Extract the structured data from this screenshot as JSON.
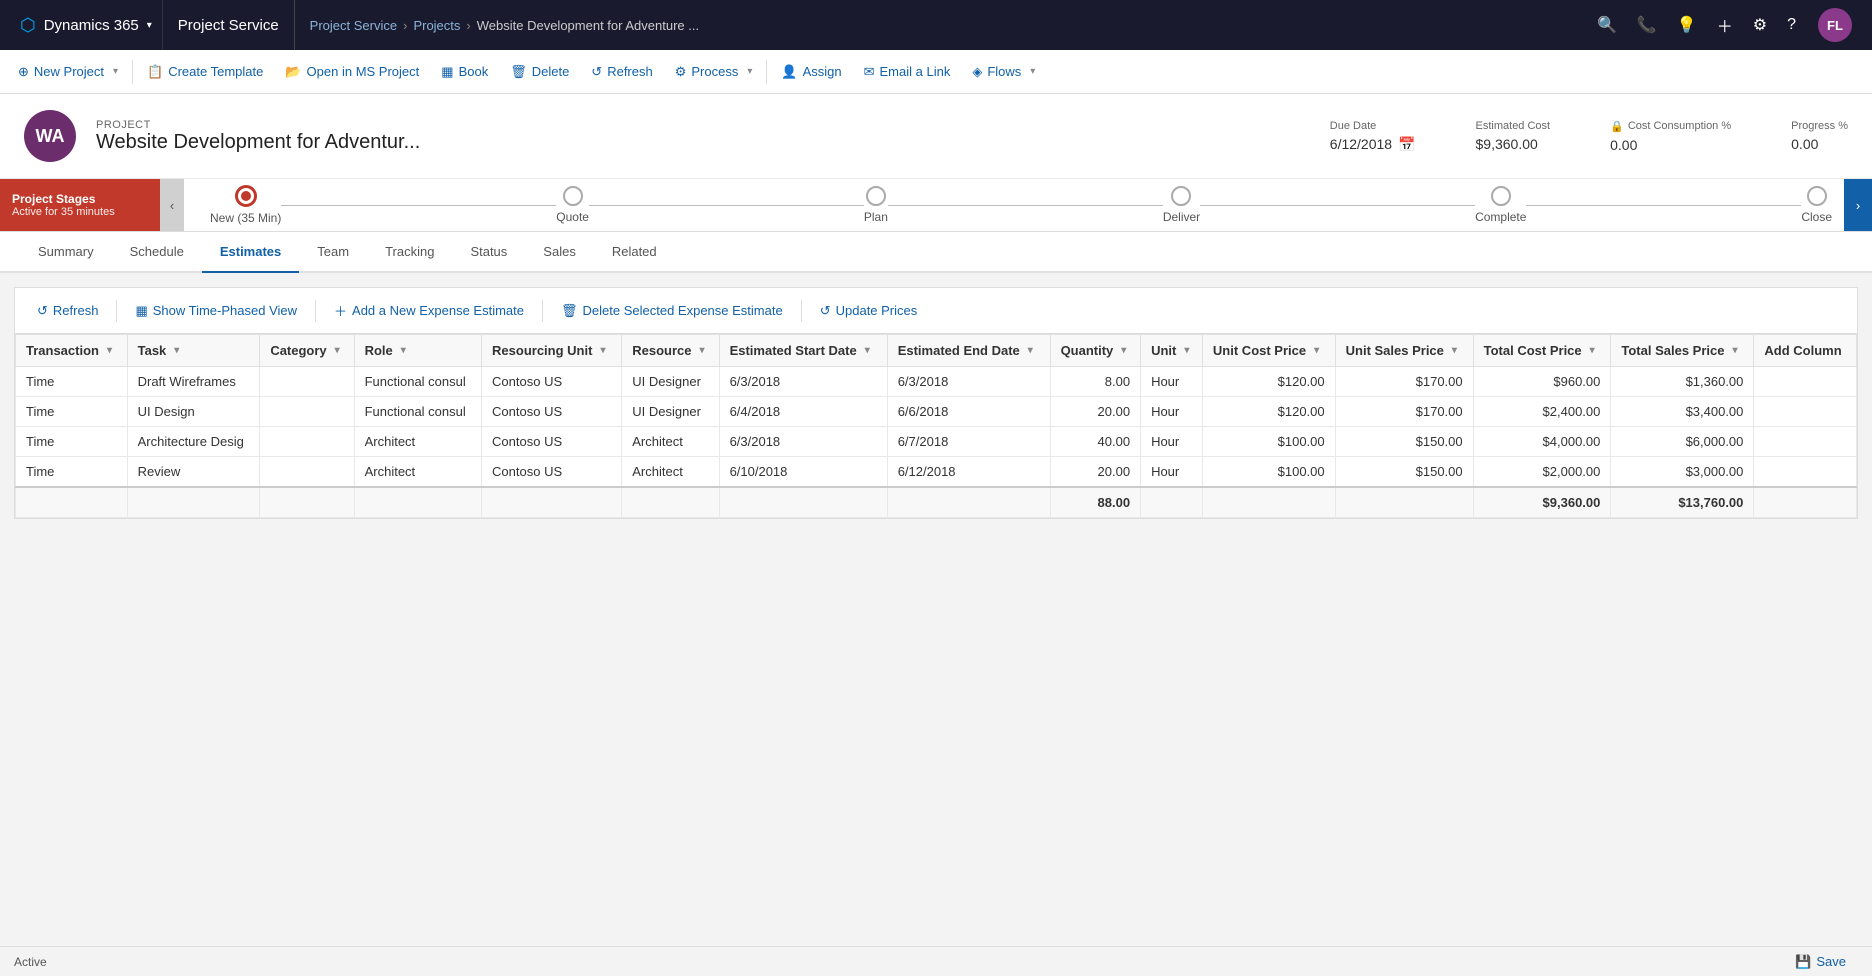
{
  "topNav": {
    "dynamics365": "Dynamics 365",
    "projectService": "Project Service",
    "breadcrumb": [
      "Project Service",
      "Projects",
      "Website Development for Adventure ..."
    ],
    "userInitials": "FL",
    "icons": [
      "search",
      "phone",
      "lightbulb",
      "plus",
      "settings",
      "question"
    ]
  },
  "commandBar": {
    "buttons": [
      {
        "id": "new-project",
        "label": "New Project",
        "icon": "⊕",
        "hasSplit": true
      },
      {
        "id": "create-template",
        "label": "Create Template",
        "icon": "📋"
      },
      {
        "id": "open-ms-project",
        "label": "Open in MS Project",
        "icon": "📁"
      },
      {
        "id": "book",
        "label": "Book",
        "icon": "▦"
      },
      {
        "id": "delete",
        "label": "Delete",
        "icon": "🗑"
      },
      {
        "id": "refresh",
        "label": "Refresh",
        "icon": "↺"
      },
      {
        "id": "process",
        "label": "Process",
        "icon": "⚙",
        "hasSplit": true
      },
      {
        "id": "assign",
        "label": "Assign",
        "icon": "👤"
      },
      {
        "id": "email-link",
        "label": "Email a Link",
        "icon": "✉"
      },
      {
        "id": "flows",
        "label": "Flows",
        "icon": "◈",
        "hasSplit": true
      }
    ]
  },
  "project": {
    "label": "PROJECT",
    "title": "Website Development for Adventur...",
    "iconText": "WA",
    "dueDate": {
      "label": "Due Date",
      "value": "6/12/2018"
    },
    "estimatedCost": {
      "label": "Estimated Cost",
      "value": "$9,360.00"
    },
    "costConsumption": {
      "label": "Cost Consumption %",
      "value": "0.00"
    },
    "progress": {
      "label": "Progress %",
      "value": "0.00"
    }
  },
  "stages": {
    "panelTitle": "Project Stages",
    "panelSub": "Active for 35 minutes",
    "steps": [
      {
        "label": "New (35 Min)",
        "active": true
      },
      {
        "label": "Quote",
        "active": false
      },
      {
        "label": "Plan",
        "active": false
      },
      {
        "label": "Deliver",
        "active": false
      },
      {
        "label": "Complete",
        "active": false
      },
      {
        "label": "Close",
        "active": false
      }
    ]
  },
  "tabs": [
    {
      "id": "summary",
      "label": "Summary",
      "active": false
    },
    {
      "id": "schedule",
      "label": "Schedule",
      "active": false
    },
    {
      "id": "estimates",
      "label": "Estimates",
      "active": true
    },
    {
      "id": "team",
      "label": "Team",
      "active": false
    },
    {
      "id": "tracking",
      "label": "Tracking",
      "active": false
    },
    {
      "id": "status",
      "label": "Status",
      "active": false
    },
    {
      "id": "sales",
      "label": "Sales",
      "active": false
    },
    {
      "id": "related",
      "label": "Related",
      "active": false
    }
  ],
  "estimatesToolbar": {
    "refresh": "Refresh",
    "showTimePhased": "Show Time-Phased View",
    "addExpense": "Add a New Expense Estimate",
    "deleteExpense": "Delete Selected Expense Estimate",
    "updatePrices": "Update Prices"
  },
  "estimatesGrid": {
    "columns": [
      {
        "id": "transaction",
        "label": "Transaction",
        "sortable": true
      },
      {
        "id": "task",
        "label": "Task",
        "sortable": true
      },
      {
        "id": "category",
        "label": "Category",
        "sortable": true
      },
      {
        "id": "role",
        "label": "Role",
        "sortable": true
      },
      {
        "id": "resourcingUnit",
        "label": "Resourcing Unit",
        "sortable": true
      },
      {
        "id": "resource",
        "label": "Resource",
        "sortable": true
      },
      {
        "id": "estStartDate",
        "label": "Estimated Start Date",
        "sortable": true
      },
      {
        "id": "estEndDate",
        "label": "Estimated End Date",
        "sortable": true
      },
      {
        "id": "quantity",
        "label": "Quantity",
        "sortable": true
      },
      {
        "id": "unit",
        "label": "Unit",
        "sortable": true
      },
      {
        "id": "unitCostPrice",
        "label": "Unit Cost Price",
        "sortable": true
      },
      {
        "id": "unitSalesPrice",
        "label": "Unit Sales Price",
        "sortable": true
      },
      {
        "id": "totalCostPrice",
        "label": "Total Cost Price",
        "sortable": true
      },
      {
        "id": "totalSalesPrice",
        "label": "Total Sales Price",
        "sortable": true
      },
      {
        "id": "addColumn",
        "label": "Add Column",
        "sortable": false
      }
    ],
    "rows": [
      {
        "transaction": "Time",
        "task": "Draft Wireframes",
        "category": "",
        "role": "Functional consul",
        "resourcingUnit": "Contoso US",
        "resource": "UI Designer",
        "estStartDate": "6/3/2018",
        "estEndDate": "6/3/2018",
        "quantity": "8.00",
        "unit": "Hour",
        "unitCostPrice": "$120.00",
        "unitSalesPrice": "$170.00",
        "totalCostPrice": "$960.00",
        "totalSalesPrice": "$1,360.00",
        "addColumn": ""
      },
      {
        "transaction": "Time",
        "task": "UI Design",
        "category": "",
        "role": "Functional consul",
        "resourcingUnit": "Contoso US",
        "resource": "UI Designer",
        "estStartDate": "6/4/2018",
        "estEndDate": "6/6/2018",
        "quantity": "20.00",
        "unit": "Hour",
        "unitCostPrice": "$120.00",
        "unitSalesPrice": "$170.00",
        "totalCostPrice": "$2,400.00",
        "totalSalesPrice": "$3,400.00",
        "addColumn": ""
      },
      {
        "transaction": "Time",
        "task": "Architecture Desig",
        "category": "",
        "role": "Architect",
        "resourcingUnit": "Contoso US",
        "resource": "Architect",
        "estStartDate": "6/3/2018",
        "estEndDate": "6/7/2018",
        "quantity": "40.00",
        "unit": "Hour",
        "unitCostPrice": "$100.00",
        "unitSalesPrice": "$150.00",
        "totalCostPrice": "$4,000.00",
        "totalSalesPrice": "$6,000.00",
        "addColumn": ""
      },
      {
        "transaction": "Time",
        "task": "Review",
        "category": "",
        "role": "Architect",
        "resourcingUnit": "Contoso US",
        "resource": "Architect",
        "estStartDate": "6/10/2018",
        "estEndDate": "6/12/2018",
        "quantity": "20.00",
        "unit": "Hour",
        "unitCostPrice": "$100.00",
        "unitSalesPrice": "$150.00",
        "totalCostPrice": "$2,000.00",
        "totalSalesPrice": "$3,000.00",
        "addColumn": ""
      }
    ],
    "footer": {
      "totalQuantity": "88.00",
      "totalCostPrice": "$9,360.00",
      "totalSalesPrice": "$13,760.00"
    }
  },
  "statusBar": {
    "status": "Active",
    "saveLabel": "Save"
  }
}
